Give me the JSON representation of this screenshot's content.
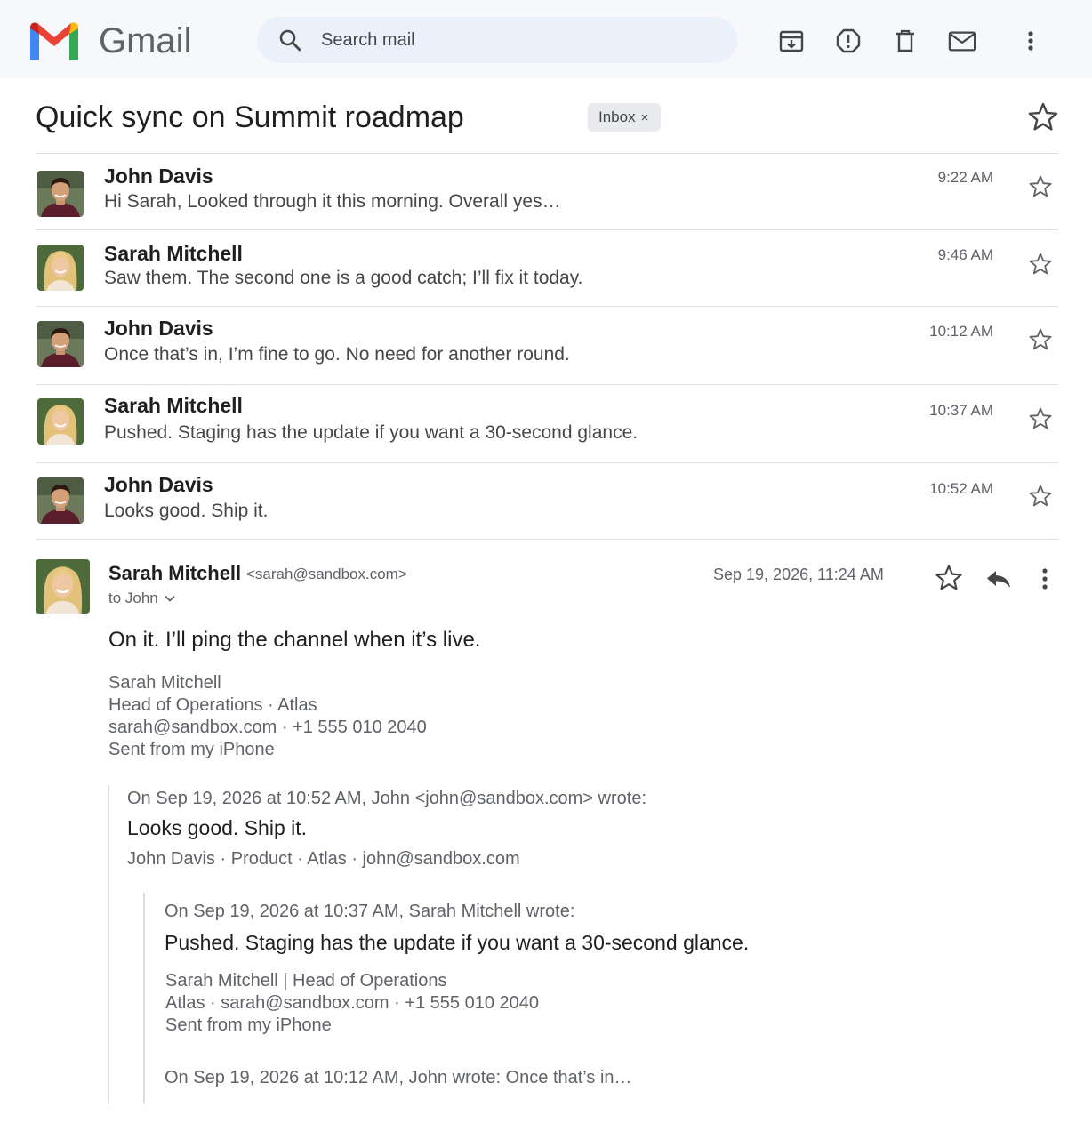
{
  "app": {
    "brand": "Gmail",
    "colors": {
      "header_bg": "#f6f8fc",
      "search_bg": "#eaf1fb",
      "accent_red": "#ea4335",
      "accent_blue": "#4285f4",
      "accent_green": "#34a853",
      "accent_yellow": "#fbbc04"
    }
  },
  "search": {
    "placeholder": "Search mail"
  },
  "toolbar": {
    "icons": [
      "archive-icon",
      "report-spam-icon",
      "delete-icon",
      "mark-unread-icon",
      "more-vert-icon"
    ]
  },
  "thread": {
    "subject": "Quick sync on Summit roadmap",
    "label": "Inbox",
    "label_remove": "×"
  },
  "messages": [
    {
      "sender": "John Davis",
      "snippet": "Hi Sarah, Looked through it this morning. Overall yes…",
      "time": "9:22 AM",
      "avatar": "john"
    },
    {
      "sender": "Sarah Mitchell",
      "snippet": "Saw them. The second one is a good catch; I’ll fix it today.",
      "time": "9:46 AM",
      "avatar": "sarah"
    },
    {
      "sender": "John Davis",
      "snippet": "Once that’s in, I’m fine to go. No need for another round.",
      "time": "10:12 AM",
      "avatar": "john"
    },
    {
      "sender": "Sarah Mitchell",
      "snippet": "Pushed. Staging has the update if you want a 30-second glance.",
      "time": "10:37 AM",
      "avatar": "sarah"
    },
    {
      "sender": "John Davis",
      "snippet": "Looks good. Ship it.",
      "time": "10:52 AM",
      "avatar": "john"
    }
  ],
  "expanded": {
    "sender": "Sarah Mitchell",
    "email": "<sarah@sandbox.com>",
    "to": "to John",
    "date": "Sep 19, 2026, 11:24 AM",
    "body": "On it. I’ll ping the channel when it’s live.",
    "signature": [
      "Sarah Mitchell",
      "Head of Operations · Atlas",
      "sarah@sandbox.com · +1 555 010 2040",
      "Sent from my iPhone"
    ],
    "quote1": {
      "header": "On Sep 19, 2026 at 10:52 AM, John <john@sandbox.com> wrote:",
      "body": "Looks good. Ship it.",
      "signature": "John Davis · Product · Atlas · john@sandbox.com"
    },
    "quote2": {
      "header": "On Sep 19, 2026 at 10:37 AM, Sarah Mitchell wrote:",
      "body": "Pushed. Staging has the update if you want a 30-second glance.",
      "signature": [
        "Sarah Mitchell | Head of Operations",
        "Atlas · sarah@sandbox.com · +1 555 010 2040",
        "Sent from my iPhone"
      ],
      "more": "On Sep 19, 2026 at 10:12 AM, John wrote: Once that’s in…"
    }
  }
}
